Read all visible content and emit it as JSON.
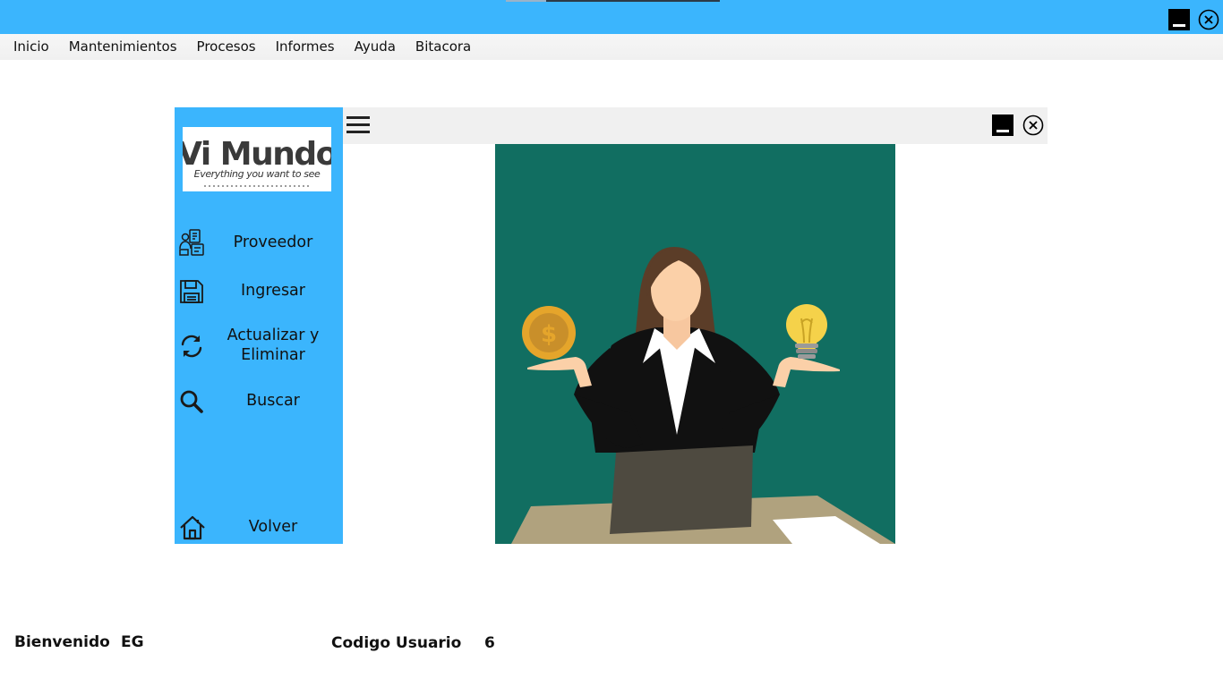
{
  "menubar": {
    "items": [
      "Inicio",
      "Mantenimientos",
      "Procesos",
      "Informes",
      "Ayuda",
      "Bitacora"
    ]
  },
  "logo": {
    "title": "Vi Mundo",
    "tagline": "Everything you want to see"
  },
  "sidebar": {
    "items": [
      {
        "label": "Proveedor",
        "icon": "supplier-icon"
      },
      {
        "label": "Ingresar",
        "icon": "save-icon"
      },
      {
        "label": "Actualizar y Eliminar",
        "icon": "refresh-icon"
      },
      {
        "label": "Buscar",
        "icon": "search-icon"
      },
      {
        "label": "Volver",
        "icon": "home-icon"
      }
    ]
  },
  "footer": {
    "welcome_label": "Bienvenido",
    "user_name": "EG",
    "user_code_label": "Codigo Usuario",
    "user_code": "6"
  },
  "colors": {
    "accent": "#3bb5fd",
    "image_bg": "#116e61"
  }
}
